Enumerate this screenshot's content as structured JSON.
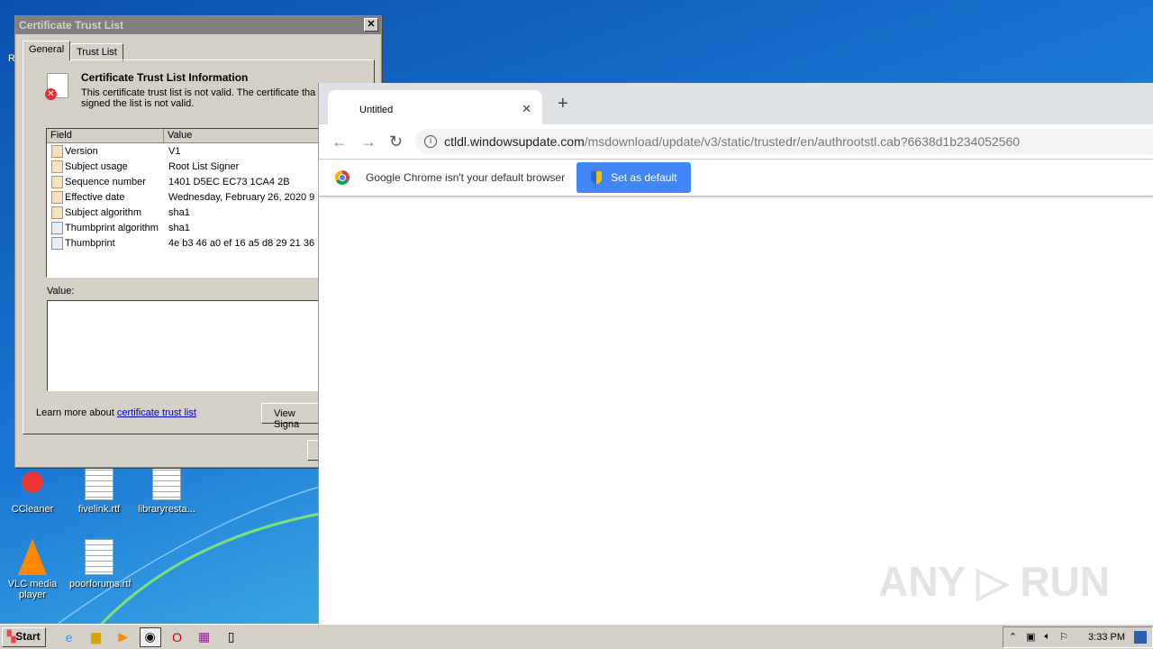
{
  "desktop": {
    "icons": [
      {
        "label": "CCleaner"
      },
      {
        "label": "fivelink.rtf"
      },
      {
        "label": "libraryresta..."
      },
      {
        "label": "VLC media player"
      },
      {
        "label": "poorforums.rtf"
      }
    ],
    "partial_label": "R"
  },
  "dialog": {
    "title": "Certificate Trust List",
    "tabs": [
      "General",
      "Trust List"
    ],
    "info_title": "Certificate Trust List Information",
    "info_text1": "This certificate trust list is not valid.  The certificate tha",
    "info_text2": "signed the list is not valid.",
    "columns": [
      "Field",
      "Value"
    ],
    "rows": [
      {
        "field": "Version",
        "value": "V1",
        "icon": "doc-orange"
      },
      {
        "field": "Subject usage",
        "value": "Root List Signer",
        "icon": "doc-orange"
      },
      {
        "field": "Sequence number",
        "value": "1401 D5EC EC73 1CA4 2B",
        "icon": "doc-orange"
      },
      {
        "field": "Effective date",
        "value": "Wednesday, February 26, 2020 9",
        "icon": "doc-orange"
      },
      {
        "field": "Subject algorithm",
        "value": "sha1",
        "icon": "doc-orange"
      },
      {
        "field": "Thumbprint algorithm",
        "value": "sha1",
        "icon": "doc-blue"
      },
      {
        "field": "Thumbprint",
        "value": "4e b3 46 a0 ef 16 a5 d8 29 21 36",
        "icon": "doc-blue"
      }
    ],
    "value_label": "Value:",
    "learn_more": "Learn more about ",
    "learn_link": "certificate trust list",
    "view_sig": "View Signa"
  },
  "chrome": {
    "tab_title": "Untitled",
    "url_host": "ctldl.windowsupdate.com",
    "url_path": "/msdownload/update/v3/static/trustedr/en/authrootstl.cab?6638d1b234052560",
    "infobar_text": "Google Chrome isn't your default browser",
    "set_default": "Set as default",
    "accent": "#4285f4"
  },
  "taskbar": {
    "start": "Start",
    "clock": "3:33 PM"
  }
}
